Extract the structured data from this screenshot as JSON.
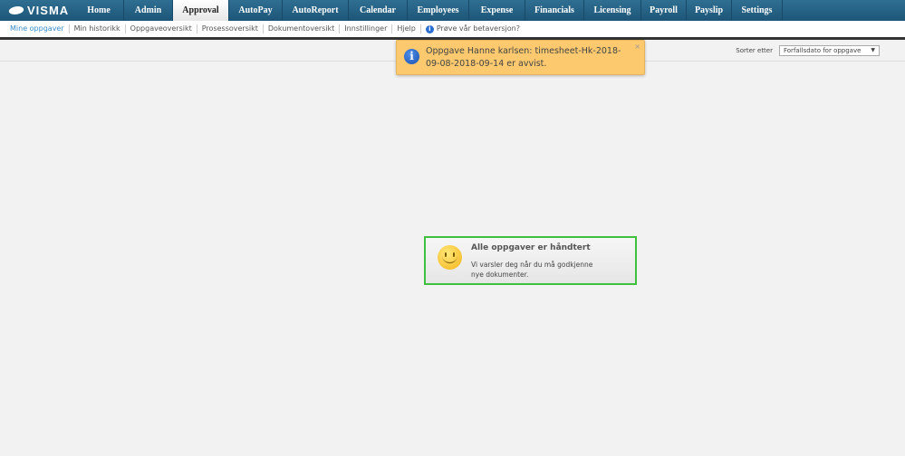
{
  "logo": "VISMA",
  "nav": [
    {
      "label": "Home",
      "w": 55
    },
    {
      "label": "Admin",
      "w": 54
    },
    {
      "label": "Approval",
      "w": 62,
      "active": true
    },
    {
      "label": "AutoPay",
      "w": 59
    },
    {
      "label": "AutoReport",
      "w": 73
    },
    {
      "label": "Calendar",
      "w": 65
    },
    {
      "label": "Employees",
      "w": 68
    },
    {
      "label": "Expense",
      "w": 62
    },
    {
      "label": "Financials",
      "w": 65
    },
    {
      "label": "Licensing",
      "w": 63
    },
    {
      "label": "Payroll",
      "w": 50
    },
    {
      "label": "Payslip",
      "w": 50
    },
    {
      "label": "Settings",
      "w": 56
    }
  ],
  "subnav": [
    "Mine oppgaver",
    "Min historikk",
    "Oppgaveoversikt",
    "Prosessoversikt",
    "Dokumentoversikt",
    "Innstillinger",
    "Hjelp"
  ],
  "beta_link": "Prøve vår betaversjon?",
  "sort": {
    "label": "Sorter etter",
    "value": "Forfallsdato for oppgave"
  },
  "toast": {
    "message": "Oppgave Hanne karlsen: timesheet-Hk-2018-09-08-2018-09-14 er avvist.",
    "close": "×"
  },
  "empty": {
    "title": "Alle oppgaver er håndtert",
    "text": "Vi varsler deg når du må godkjenne nye dokumenter."
  }
}
